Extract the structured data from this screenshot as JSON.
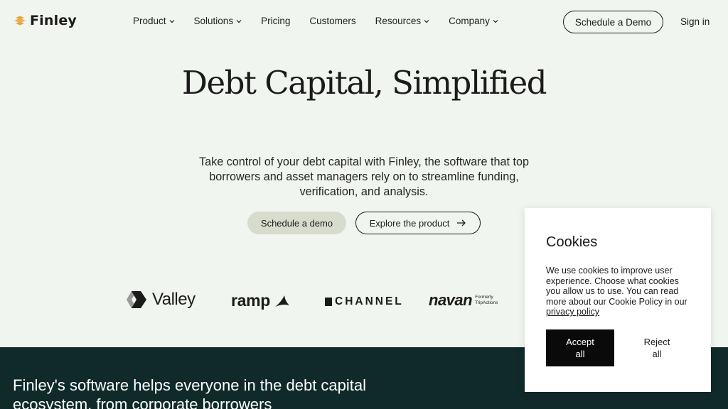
{
  "header": {
    "logo_text": "Finley",
    "nav": [
      {
        "label": "Product",
        "has_dropdown": true
      },
      {
        "label": "Solutions",
        "has_dropdown": true
      },
      {
        "label": "Pricing",
        "has_dropdown": false
      },
      {
        "label": "Customers",
        "has_dropdown": false
      },
      {
        "label": "Resources",
        "has_dropdown": true
      },
      {
        "label": "Company",
        "has_dropdown": true
      }
    ],
    "demo_button": "Schedule a Demo",
    "signin": "Sign in"
  },
  "hero": {
    "title": "Debt Capital, Simplified",
    "subtitle": "Take control of your debt capital with Finley, the software that top borrowers and asset managers rely on to streamline funding, verification, and analysis.",
    "primary_button": "Schedule a demo",
    "secondary_button": "Explore the product"
  },
  "customer_logos": {
    "valley": "Valley",
    "ramp": "ramp",
    "channel": "CHANNEL",
    "navan": "navan",
    "navan_note_line1": "Formerly",
    "navan_note_line2": "TripActions"
  },
  "section": {
    "text": "Finley's software helps everyone in the debt capital ecosystem, from corporate borrowers"
  },
  "cookie": {
    "title": "Cookies",
    "body": "We use cookies to improve user experience. Choose what cookies you allow us to use. You can read more about our Cookie Policy in our ",
    "link": "privacy policy",
    "accept_line1": "Accept",
    "accept_line2": "all",
    "reject_line1": "Reject",
    "reject_line2": "all"
  },
  "colors": {
    "page_background": "#f1f5ef",
    "brand_orange": "#e8a33a",
    "dark_section": "#102a2a",
    "primary_button_bg": "#d8dccc",
    "accept_button_bg": "#0a0a0a"
  },
  "icons": [
    "finley-logo-icon",
    "chevron-down-icon",
    "arrow-right-icon",
    "valley-logo-icon",
    "ramp-logo-icon",
    "channel-logo-icon"
  ]
}
